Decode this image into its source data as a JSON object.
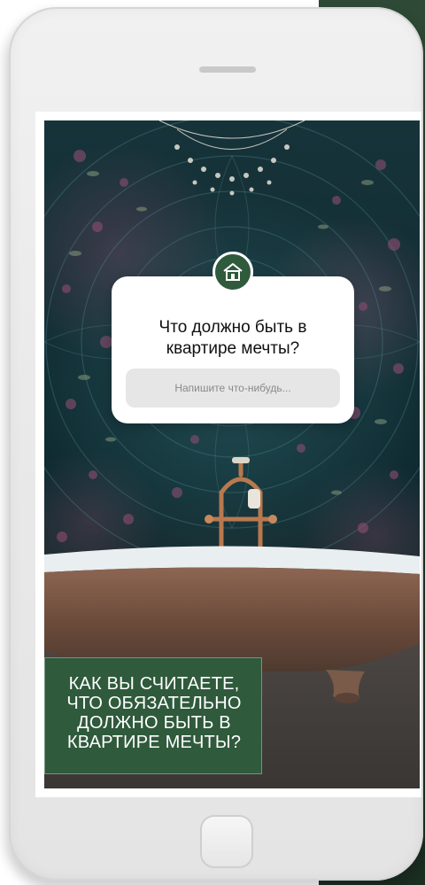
{
  "story": {
    "question_title": "Что должно быть в\nквартире мечты?",
    "answer_placeholder": "Напишите что-нибудь...",
    "avatar_icon": "home-logo-icon",
    "banner_text": "КАК ВЫ СЧИТАЕТЕ,\nЧТО ОБЯЗАТЕЛЬНО\nДОЛЖНО БЫТЬ В\nКВАРТИРЕ МЕЧТЫ?"
  },
  "colors": {
    "brand_green": "#2f5a3c",
    "card_bg": "#ffffff",
    "input_bg": "#e6e6e6",
    "background_green": "#2e4a36"
  }
}
